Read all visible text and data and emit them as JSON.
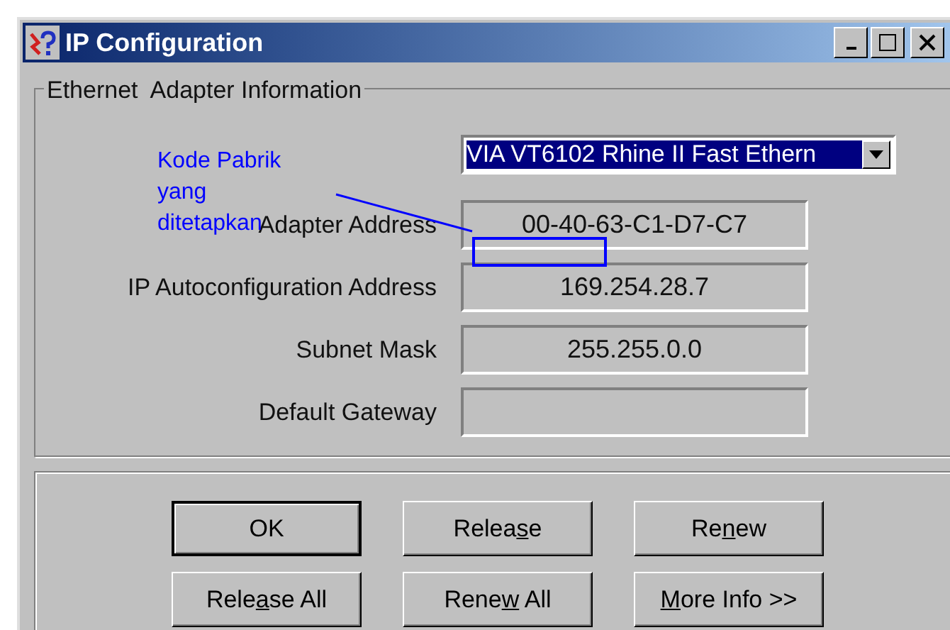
{
  "window": {
    "title": "IP Configuration"
  },
  "adapter_group": {
    "title": "Ethernet  Adapter Information",
    "adapter_select": {
      "value": "VIA VT6102 Rhine II Fast Ethern"
    },
    "fields": [
      {
        "label": "Adapter Address",
        "value": "00-40-63-C1-D7-C7"
      },
      {
        "label": "IP Autoconfiguration Address",
        "value": "169.254.28.7"
      },
      {
        "label": "Subnet Mask",
        "value": "255.255.0.0"
      },
      {
        "label": "Default Gateway"
      }
    ]
  },
  "buttons": [
    {
      "label": {
        "before": "OK"
      },
      "default": true
    },
    {
      "label": {
        "before": "Relea",
        "access_key": "s",
        "after": "e"
      },
      "default": false
    },
    {
      "label": {
        "before": "Re",
        "access_key": "n",
        "after": "ew"
      },
      "default": false
    },
    {
      "label": {
        "before": "Rele",
        "access_key": "a",
        "after": "se All"
      },
      "default": false
    },
    {
      "label": {
        "before": "Rene",
        "access_key": "w",
        "after": " All"
      },
      "default": false
    },
    {
      "label": {
        "access_key": "M",
        "after": "ore Info >>"
      },
      "default": false
    }
  ],
  "annotation": {
    "lines": [
      "Kode Pabrik",
      "yang",
      "ditetapkan"
    ]
  }
}
